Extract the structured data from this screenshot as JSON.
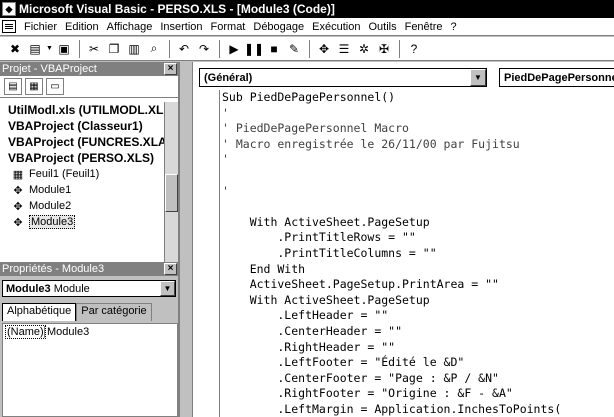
{
  "window": {
    "title": "Microsoft Visual Basic - PERSO.XLS - [Module3 (Code)]"
  },
  "menu": [
    "Fichier",
    "Edition",
    "Affichage",
    "Insertion",
    "Format",
    "Débogage",
    "Exécution",
    "Outils",
    "Fenêtre",
    "?"
  ],
  "toolbar": {
    "icons": [
      "excel-icon",
      "insert-module-icon",
      "save-icon",
      "cut-icon",
      "copy-icon",
      "paste-icon",
      "find-icon",
      "undo-icon",
      "redo-icon",
      "run-icon",
      "break-icon",
      "reset-icon",
      "design-mode-icon",
      "project-explorer-icon",
      "properties-icon",
      "object-browser-icon",
      "toolbox-icon",
      "help-icon"
    ]
  },
  "project_panel": {
    "title": "Projet - VBAProject",
    "items": [
      {
        "label": "UtilModl.xls (UTILMODL.XLA",
        "bold": true,
        "icon": ""
      },
      {
        "label": "VBAProject (Classeur1)",
        "bold": true,
        "icon": ""
      },
      {
        "label": "VBAProject (FUNCRES.XLA)",
        "bold": true,
        "icon": ""
      },
      {
        "label": "VBAProject (PERSO.XLS)",
        "bold": true,
        "icon": ""
      },
      {
        "label": "Feuil1 (Feuil1)",
        "bold": false,
        "icon": "sheet-icon"
      },
      {
        "label": "Module1",
        "bold": false,
        "icon": "module-icon"
      },
      {
        "label": "Module2",
        "bold": false,
        "icon": "module-icon"
      },
      {
        "label": "Module3",
        "bold": false,
        "icon": "module-icon",
        "selected": true
      }
    ]
  },
  "properties_panel": {
    "title": "Propriétés - Module3",
    "object_name": "Module3",
    "object_type": "Module",
    "tabs": [
      "Alphabétique",
      "Par catégorie"
    ],
    "active_tab": "Alphabétique",
    "rows": [
      {
        "name": "(Name)",
        "value": "Module3"
      }
    ]
  },
  "code_window": {
    "object_combo": "(Général)",
    "procedure_combo": "PiedDePagePersonnel",
    "lines": [
      "Sub PiedDePagePersonnel()",
      "'",
      "' PiedDePagePersonnel Macro",
      "' Macro enregistrée le 26/11/00 par Fujitsu",
      "'",
      "",
      "'",
      "",
      "    With ActiveSheet.PageSetup",
      "        .PrintTitleRows = \"\"",
      "        .PrintTitleColumns = \"\"",
      "    End With",
      "    ActiveSheet.PageSetup.PrintArea = \"\"",
      "    With ActiveSheet.PageSetup",
      "        .LeftHeader = \"\"",
      "        .CenterHeader = \"\"",
      "        .RightHeader = \"\"",
      "        .LeftFooter = \"Édité le &D\"",
      "        .CenterFooter = \"Page : &P / &N\"",
      "        .RightFooter = \"Origine : &F - &A\"",
      "        .LeftMargin = Application.InchesToPoints("
    ]
  }
}
